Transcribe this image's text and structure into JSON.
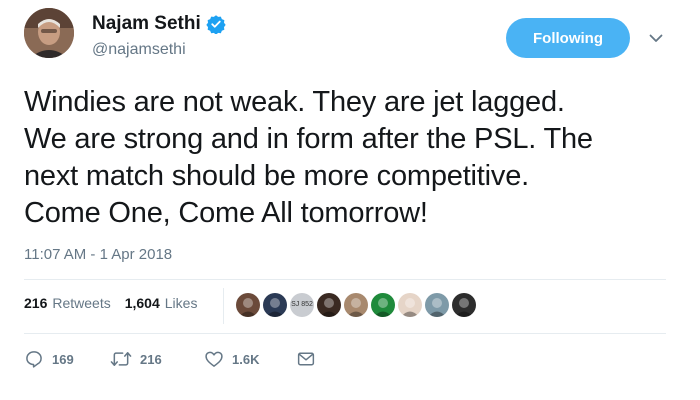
{
  "author": {
    "name": "Najam Sethi",
    "handle": "@najamsethi",
    "verified": true
  },
  "follow_button": {
    "label": "Following"
  },
  "tweet": {
    "text": "Windies are not weak. They are jet lagged.\nWe are strong and in form after the PSL. The\nnext match should be more competitive.\nCome One, Come All tomorrow!",
    "timestamp": "11:07 AM - 1 Apr 2018"
  },
  "stats": {
    "retweets_count": "216",
    "retweets_label": "Retweets",
    "likes_count": "1,604",
    "likes_label": "Likes"
  },
  "likers": [
    {
      "color": "#6b4a3a"
    },
    {
      "color": "#2b3a55"
    },
    {
      "color": "#c9ccd1",
      "text": "SJ 852"
    },
    {
      "color": "#3a2a22"
    },
    {
      "color": "#a8896e"
    },
    {
      "color": "#1f8a3b"
    },
    {
      "color": "#e6d5c8"
    },
    {
      "color": "#7e9aa8"
    },
    {
      "color": "#2d2d2d"
    }
  ],
  "actions": {
    "reply_count": "169",
    "retweet_count": "216",
    "like_count": "1.6K"
  },
  "colors": {
    "accent": "#4ab3f4",
    "secondary_text": "#657786",
    "primary_text": "#14171a",
    "divider": "#e6ecf0"
  }
}
